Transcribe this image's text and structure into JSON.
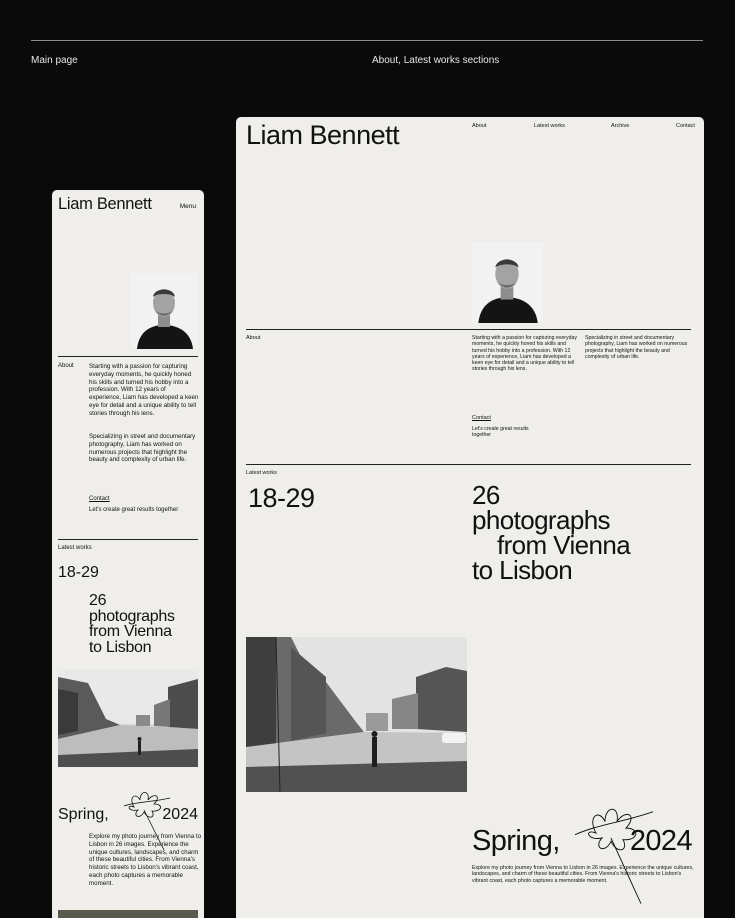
{
  "captions": {
    "left": "Main page",
    "right": "About, Latest works sections"
  },
  "mobile": {
    "name": "Liam Bennett",
    "menu": "Menu",
    "about_label": "About",
    "about_p1": "Starting with a passion for capturing everyday moments, he quickly honed his skills and turned his hobby into a profession. With 12 years of experience, Liam has developed a keen eye for detail and a unique ability to tell stories through his lens.",
    "about_p2": "Specializing in street and documentary photography, Liam has worked on numerous projects that highlight the beauty and complexity of urban life.",
    "contact": "Contact",
    "cta": "Let's create great results together",
    "works_label": "Latest works",
    "range": "18-29",
    "big_line1": "26",
    "big_line2": "photographs",
    "big_line3": "from Vienna",
    "big_line4": "to Lisbon",
    "spring": "Spring,",
    "year": "2024",
    "desc": "Explore my photo journey from Vienna to Lisbon in 26 images. Experience the unique cultures, landscapes, and charm of these beautiful cities. From Vienna's historic streets to Lisbon's vibrant coast, each photo captures a memorable moment."
  },
  "desktop": {
    "name": "Liam Bennett",
    "nav": [
      "About",
      "Latest works",
      "Archive",
      "Contact"
    ],
    "about_label": "About",
    "col1": "Starting with a passion for capturing everyday moments, he quickly honed his skills and turned his hobby into a profession. With 12 years of experience, Liam has developed a keen eye for detail and a unique ability to tell stories through his lens.",
    "col2": "Specializing in street and documentary photography, Liam has worked on numerous projects that highlight the beauty and complexity of urban life.",
    "contact": "Contact",
    "cta": "Let's create great results together",
    "works_label": "Latest works",
    "range": "18-29",
    "big_line1": "26",
    "big_line2": "photographs",
    "big_line3": "from Vienna",
    "big_line4": "to Lisbon",
    "spring": "Spring,",
    "year": "2024",
    "desc": "Explore my photo journey from Vienna to Lisbon in 26 images. Experience the unique cultures, landscapes, and charm of these beautiful cities. From Vienna's historic streets to Lisbon's vibrant coast, each photo captures a memorable moment."
  }
}
